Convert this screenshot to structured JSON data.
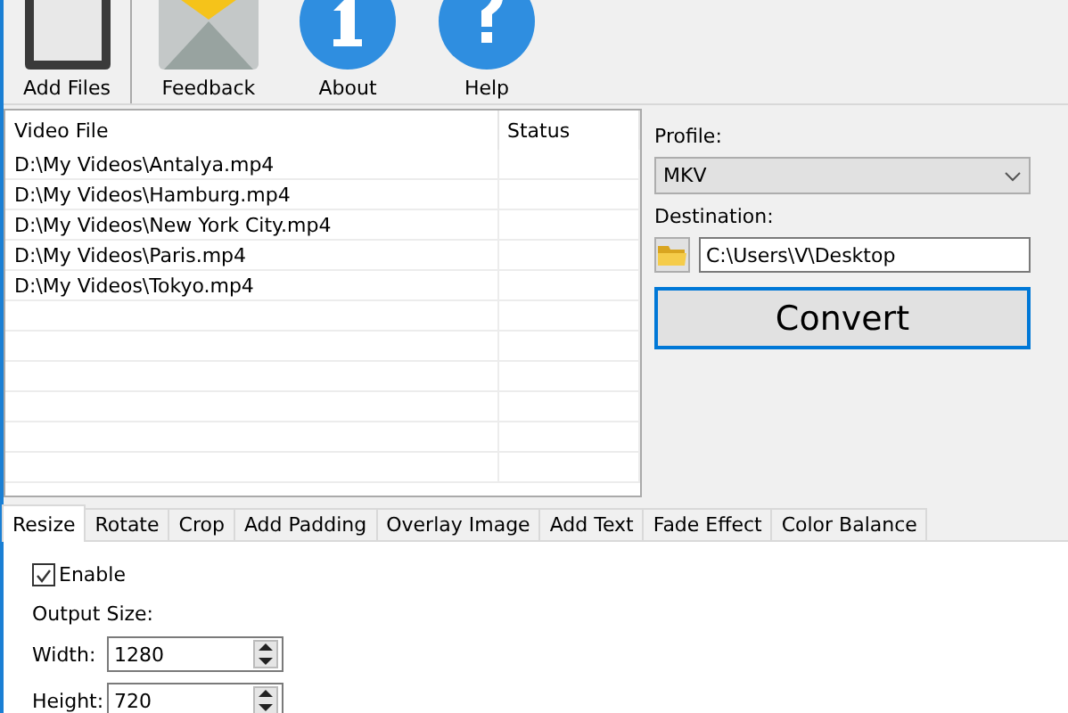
{
  "toolbar": [
    {
      "label": "Add Files",
      "kind": "file"
    },
    {
      "label": "Feedback",
      "kind": "mail"
    },
    {
      "label": "About",
      "kind": "info"
    },
    {
      "label": "Help",
      "kind": "help"
    }
  ],
  "table": {
    "columns": [
      "Video File",
      "Status"
    ],
    "rows": [
      [
        "D:\\My Videos\\Antalya.mp4",
        ""
      ],
      [
        "D:\\My Videos\\Hamburg.mp4",
        ""
      ],
      [
        "D:\\My Videos\\New York City.mp4",
        ""
      ],
      [
        "D:\\My Videos\\Paris.mp4",
        ""
      ],
      [
        "D:\\My Videos\\Tokyo.mp4",
        ""
      ]
    ]
  },
  "profile": {
    "label": "Profile:",
    "value": "MKV"
  },
  "destination": {
    "label": "Destination:",
    "value": "C:\\Users\\V\\Desktop"
  },
  "convert_button": "Convert",
  "tabs": [
    {
      "label": "Resize",
      "selected": true
    },
    {
      "label": "Rotate",
      "selected": false
    },
    {
      "label": "Crop",
      "selected": false
    },
    {
      "label": "Add Padding",
      "selected": false
    },
    {
      "label": "Overlay Image",
      "selected": false
    },
    {
      "label": "Add Text",
      "selected": false
    },
    {
      "label": "Fade Effect",
      "selected": false
    },
    {
      "label": "Color Balance",
      "selected": false
    }
  ],
  "resize": {
    "enable": {
      "label": "Enable",
      "checked": true
    },
    "output_size_label": "Output Size:",
    "fields": [
      {
        "label": "Width:",
        "value": "1280"
      },
      {
        "label": "Height:",
        "value": "720"
      }
    ]
  }
}
